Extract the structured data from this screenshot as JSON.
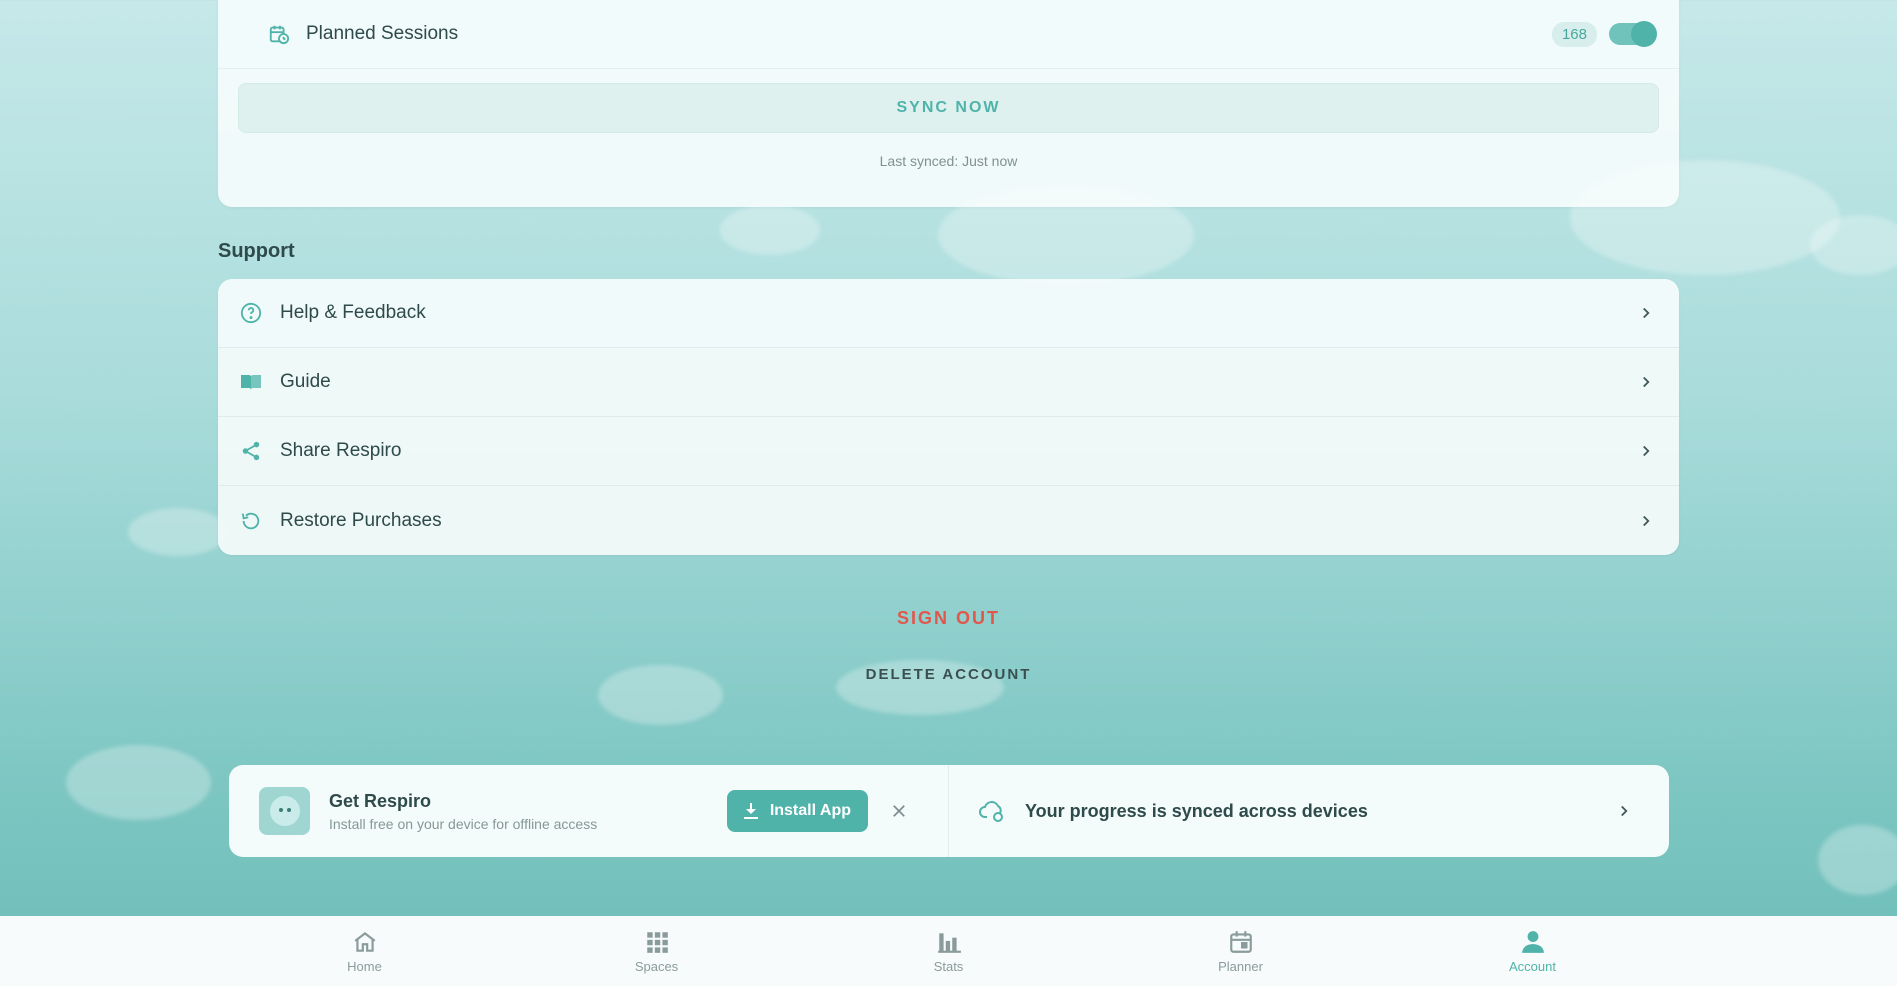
{
  "sync": {
    "planned_sessions_label": "Planned Sessions",
    "planned_sessions_count": "168",
    "sync_now_label": "SYNC NOW",
    "last_synced": "Last synced: Just now"
  },
  "support": {
    "title": "Support",
    "items": [
      {
        "label": "Help & Feedback",
        "icon": "help-circle-icon"
      },
      {
        "label": "Guide",
        "icon": "book-icon"
      },
      {
        "label": "Share Respiro",
        "icon": "share-icon"
      },
      {
        "label": "Restore Purchases",
        "icon": "restore-icon"
      }
    ]
  },
  "account_actions": {
    "sign_out": "SIGN OUT",
    "delete_account": "DELETE ACCOUNT"
  },
  "banner": {
    "title": "Get Respiro",
    "subtitle": "Install free on your device for offline access",
    "install_label": "Install App",
    "sync_message": "Your progress is synced across devices"
  },
  "nav": {
    "items": [
      {
        "label": "Home",
        "icon": "home-icon"
      },
      {
        "label": "Spaces",
        "icon": "grid-icon"
      },
      {
        "label": "Stats",
        "icon": "bar-chart-icon"
      },
      {
        "label": "Planner",
        "icon": "calendar-icon"
      },
      {
        "label": "Account",
        "icon": "person-icon"
      }
    ],
    "active": "Account"
  },
  "colors": {
    "accent": "#4fb3aa",
    "danger": "#e2574c",
    "text": "#2f4a4a"
  }
}
